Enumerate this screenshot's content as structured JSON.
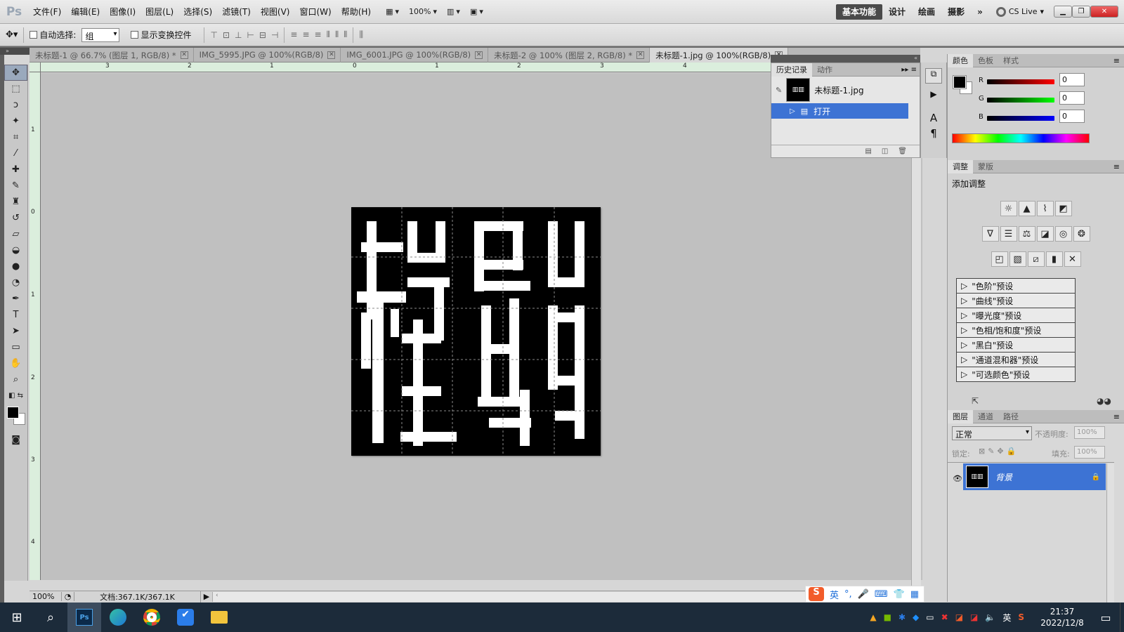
{
  "app": {
    "logo": "Ps"
  },
  "menu": [
    "文件(F)",
    "编辑(E)",
    "图像(I)",
    "图层(L)",
    "选择(S)",
    "滤镜(T)",
    "视图(V)",
    "窗口(W)",
    "帮助(H)"
  ],
  "menubar_zoom": "100%",
  "workspaces": {
    "active": "基本功能",
    "items": [
      "设计",
      "绘画",
      "摄影"
    ],
    "more": "»"
  },
  "cs_live": "CS Live",
  "options": {
    "auto_select_label": "自动选择:",
    "auto_select_value": "组",
    "transform_label": "显示变换控件"
  },
  "doc_tabs": [
    {
      "label": "未标题-1 @ 66.7% (图层 1, RGB/8) *"
    },
    {
      "label": "IMG_5995.JPG @ 100%(RGB/8)"
    },
    {
      "label": "IMG_6001.JPG @ 100%(RGB/8)"
    },
    {
      "label": "未标题-2 @ 100% (图层 2, RGB/8) *"
    },
    {
      "label": "未标题-1.jpg @ 100%(RGB/8)"
    }
  ],
  "ruler_h": [
    "3",
    "2",
    "1",
    "0",
    "1",
    "2",
    "3",
    "4"
  ],
  "ruler_v": [
    "1",
    "0",
    "1",
    "2",
    "3",
    "4"
  ],
  "status": {
    "zoom": "100%",
    "doc": "文档:367.1K/367.1K"
  },
  "history": {
    "tabs": [
      "历史记录",
      "动作"
    ],
    "snapshot": "未标题-1.jpg",
    "step": "打开"
  },
  "color": {
    "tabs": [
      "颜色",
      "色板",
      "样式"
    ],
    "channels": [
      {
        "label": "R",
        "value": "0"
      },
      {
        "label": "G",
        "value": "0"
      },
      {
        "label": "B",
        "value": "0"
      }
    ]
  },
  "adjust": {
    "tabs": [
      "调整",
      "蒙版"
    ],
    "title": "添加调整",
    "presets": [
      "\"色阶\"预设",
      "\"曲线\"预设",
      "\"曝光度\"预设",
      "\"色相/饱和度\"预设",
      "\"黑白\"预设",
      "\"通道混和器\"预设",
      "\"可选颜色\"预设"
    ]
  },
  "layers": {
    "tabs": [
      "图层",
      "通道",
      "路径"
    ],
    "blend": "正常",
    "opacity_label": "不透明度:",
    "opacity": "100%",
    "lock_label": "锁定:",
    "fill_label": "填充:",
    "fill": "100%",
    "layer_name": "背景"
  },
  "ime": {
    "label": "英"
  },
  "clock": {
    "time": "21:37",
    "date": "2022/12/8"
  },
  "tray_lang": "英"
}
